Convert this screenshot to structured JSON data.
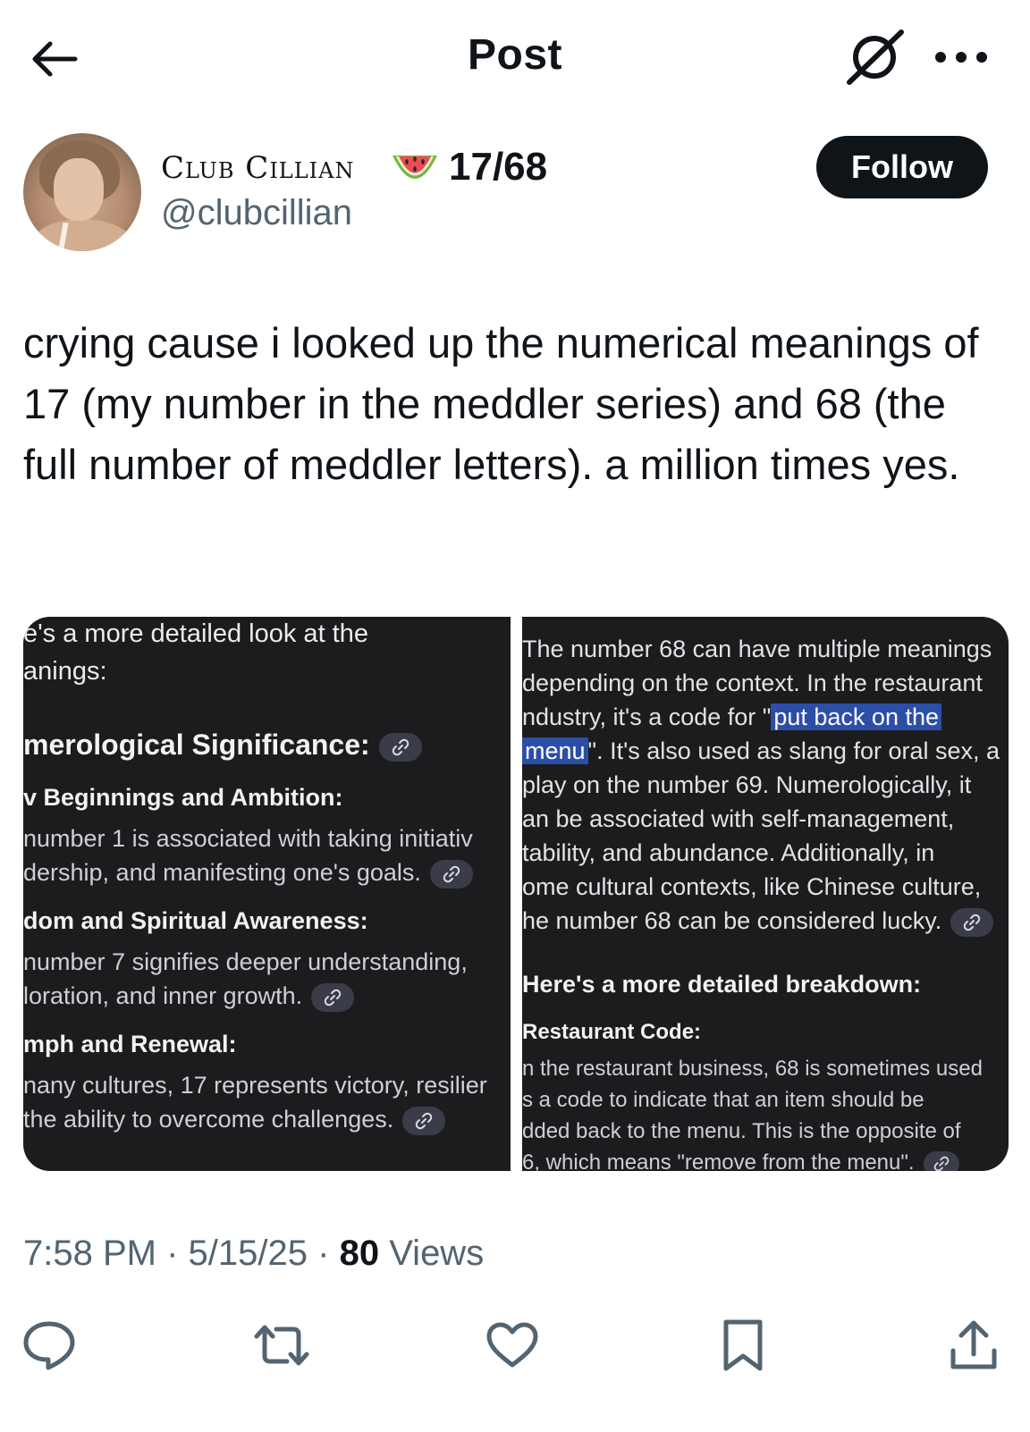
{
  "header": {
    "title": "Post",
    "back_icon": "arrow-left-icon",
    "grok_icon": "grok-icon",
    "more_icon": "more-horizontal-icon"
  },
  "author": {
    "display_name": "Club Cillian",
    "emoji": "watermelon",
    "name_suffix": "17/68",
    "handle": "@clubcillian",
    "follow_label": "Follow"
  },
  "post": {
    "text": "crying cause i looked up the numerical meanings of 17 (my number in the meddler series) and 68 (the full number of meddler letters). a million times yes."
  },
  "media": {
    "left": {
      "intro_1": "e's a more detailed look at the",
      "intro_2": "anings:",
      "heading": "merological Significance:",
      "s1_title": "v Beginnings and Ambition:",
      "s1_l1": " number 1 is associated with taking initiativ",
      "s1_l2": "dership, and manifesting one's goals.",
      "s2_title": "dom and Spiritual Awareness:",
      "s2_l1": " number 7 signifies deeper understanding,",
      "s2_l2": "loration, and inner growth.",
      "s3_title": "mph and Renewal:",
      "s3_l1": "nany cultures, 17 represents victory, resilier",
      "s3_l2": " the ability to overcome challenges."
    },
    "right": {
      "p1_l1": "The number 68 can have multiple meanings",
      "p1_l2": "depending on the context. In the restaurant",
      "p1_l3a": "ndustry, it's a code for \"",
      "p1_l3_hl": "put back on the",
      "p1_l4_hl": "menu",
      "p1_l4b": "\". It's also used as slang for oral sex, a",
      "p1_l5": "play on the number 69. Numerologically, it",
      "p1_l6": "an be associated with self-management,",
      "p1_l7": "tability, and abundance. Additionally, in",
      "p1_l8": "ome cultural contexts, like Chinese culture,",
      "p1_l9": "he number 68 can be considered lucky.",
      "heading": "Here's a more detailed breakdown:",
      "s1_title": "Restaurant Code:",
      "s1_l1": "n the restaurant business, 68 is sometimes used",
      "s1_l2": "s a code to indicate that an item should be",
      "s1_l3": "dded back to the menu. This is the opposite of",
      "s1_l4": "6, which means \"remove from the menu\"."
    },
    "link_icon": "link-icon"
  },
  "meta": {
    "time": "7:58 PM",
    "sep": "·",
    "date": "5/15/25",
    "views_count": "80",
    "views_label": "Views"
  },
  "actions": {
    "reply_icon": "reply-icon",
    "repost_icon": "repost-icon",
    "like_icon": "heart-icon",
    "bookmark_icon": "bookmark-icon",
    "share_icon": "share-icon"
  },
  "colors": {
    "text_primary": "#0f1419",
    "text_secondary": "#536471",
    "follow_bg": "#0f1419",
    "media_bg": "#1c1c1f",
    "highlight": "#2c4ea7"
  }
}
